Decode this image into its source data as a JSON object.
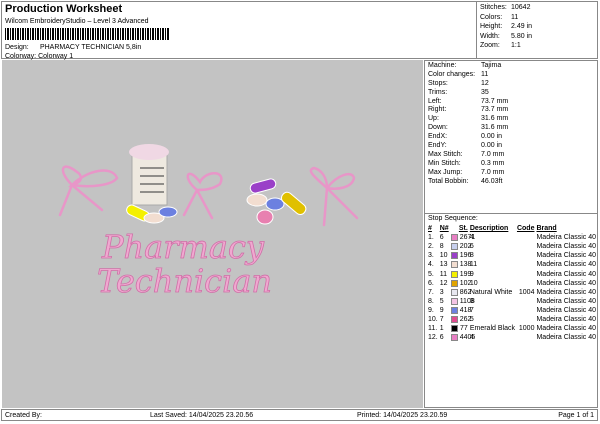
{
  "header": {
    "title": "Production Worksheet",
    "subtitle": "Wilcom EmbroideryStudio – Level 3 Advanced",
    "design_label": "Design:",
    "design": "PHARMACY TECHNICIAN 5,8in",
    "colorway_label": "Colorway:",
    "colorway": "Colorway 1"
  },
  "stats": [
    {
      "k": "Stitches:",
      "v": "10642"
    },
    {
      "k": "Colors:",
      "v": "11"
    },
    {
      "k": "Height:",
      "v": "2.49 in"
    },
    {
      "k": "Width:",
      "v": "5.80 in"
    },
    {
      "k": "Zoom:",
      "v": "1:1"
    }
  ],
  "info": [
    {
      "k": "Machine:",
      "v": "Tajima"
    },
    {
      "k": "Color changes:",
      "v": "11"
    },
    {
      "k": "Stops:",
      "v": "12"
    },
    {
      "k": "Trims:",
      "v": "35"
    },
    {
      "k": "Left:",
      "v": "73.7 mm"
    },
    {
      "k": "Right:",
      "v": "73.7 mm"
    },
    {
      "k": "Up:",
      "v": "31.6 mm"
    },
    {
      "k": "Down:",
      "v": "31.6 mm"
    },
    {
      "k": "EndX:",
      "v": "0.00 in"
    },
    {
      "k": "EndY:",
      "v": "0.00 in"
    },
    {
      "k": "Max Stitch:",
      "v": "7.0 mm"
    },
    {
      "k": "Min Stitch:",
      "v": "0.3 mm"
    },
    {
      "k": "Max Jump:",
      "v": "7.0 mm"
    },
    {
      "k": "Total Bobbin:",
      "v": "46.03ft"
    }
  ],
  "sequence": {
    "title": "Stop Sequence:",
    "headers": [
      "#",
      "N#",
      "St.",
      "Description",
      "Code",
      "Brand"
    ],
    "rows": [
      {
        "i": "1.",
        "n": "6",
        "color": "#e880c4",
        "st": "2671",
        "desc": "4",
        "code": "",
        "brand": "Madeira Classic 40"
      },
      {
        "i": "2.",
        "n": "8",
        "color": "#c8d0ee",
        "st": "202",
        "desc": "6",
        "code": "",
        "brand": "Madeira Classic 40"
      },
      {
        "i": "3.",
        "n": "10",
        "color": "#9a40c8",
        "st": "196",
        "desc": "8",
        "code": "",
        "brand": "Madeira Classic 40"
      },
      {
        "i": "4.",
        "n": "13",
        "color": "#f2ddd0",
        "st": "138",
        "desc": "11",
        "code": "",
        "brand": "Madeira Classic 40"
      },
      {
        "i": "5.",
        "n": "11",
        "color": "#f4f000",
        "st": "199",
        "desc": "9",
        "code": "",
        "brand": "Madeira Classic 40"
      },
      {
        "i": "6.",
        "n": "12",
        "color": "#e0a400",
        "st": "102",
        "desc": "10",
        "code": "",
        "brand": "Madeira Classic 40"
      },
      {
        "i": "7.",
        "n": "3",
        "color": "#e8e8f0",
        "st": "862",
        "desc": "Natural White",
        "code": "1004",
        "brand": "Madeira Classic 40"
      },
      {
        "i": "8.",
        "n": "5",
        "color": "#f4c4e4",
        "st": "1108",
        "desc": "3",
        "code": "",
        "brand": "Madeira Classic 40"
      },
      {
        "i": "9.",
        "n": "9",
        "color": "#6c80e0",
        "st": "418",
        "desc": "7",
        "code": "",
        "brand": "Madeira Classic 40"
      },
      {
        "i": "10.",
        "n": "7",
        "color": "#e04c90",
        "st": "262",
        "desc": "5",
        "code": "",
        "brand": "Madeira Classic 40"
      },
      {
        "i": "11.",
        "n": "1",
        "color": "#000000",
        "st": "77",
        "desc": "Emerald Black",
        "code": "1000",
        "brand": "Madeira Classic 40"
      },
      {
        "i": "12.",
        "n": "6",
        "color": "#e880c4",
        "st": "4405",
        "desc": "4",
        "code": "",
        "brand": "Madeira Classic 40"
      }
    ]
  },
  "design_text": {
    "line1": "Pharmacy",
    "line2": "Technician"
  },
  "footer": {
    "created": "Created By:",
    "saved": "Last Saved: 14/04/2025 23.20.56",
    "printed": "Printed: 14/04/2025 23.20.59",
    "page": "Page 1 of 1"
  }
}
